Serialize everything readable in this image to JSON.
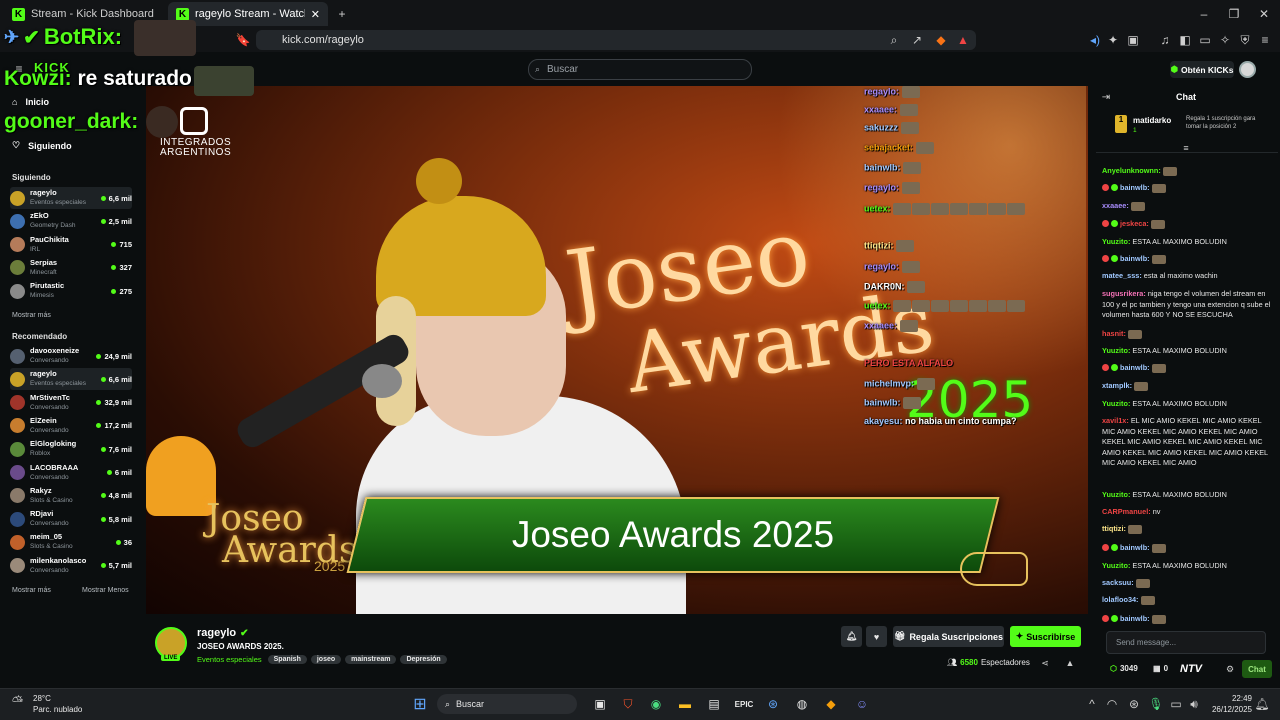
{
  "browser": {
    "tabs": [
      {
        "label": "Stream - Kick Dashboard"
      },
      {
        "label": "rageylo Stream - Watch Live"
      }
    ],
    "url": "kick.com/rageylo"
  },
  "overlay": {
    "botrix": "BotRix:",
    "kick_tag": "KICK",
    "line1_user": "Kowzi:",
    "line1_text": "re saturado",
    "line2_user": "gooner_dark:",
    "sponsor_line1": "INTEGRADOS",
    "sponsor_line2": "ARGENTINOS"
  },
  "header": {
    "search_placeholder": "Buscar",
    "kicks_label": "Obtén KICKs"
  },
  "sidebar": {
    "nav": [
      {
        "label": "Inicio",
        "icon": "home-icon"
      },
      {
        "label": "Siguiendo",
        "icon": "heart-icon"
      }
    ],
    "following_title": "Siguiendo",
    "following": [
      {
        "name": "rageylo",
        "category": "Eventos especiales",
        "viewers": "6,6 mil",
        "color": "#c9a227",
        "selected": true
      },
      {
        "name": "zEkO",
        "category": "Geometry Dash",
        "viewers": "2,5 mil",
        "color": "#3d6fb0"
      },
      {
        "name": "PauChikita",
        "category": "IRL",
        "viewers": "715",
        "color": "#b57b5a"
      },
      {
        "name": "Serpias",
        "category": "Minecraft",
        "viewers": "327",
        "color": "#6b7d3a"
      },
      {
        "name": "Pirutastic",
        "category": "Mimesis",
        "viewers": "275",
        "color": "#8a8a8a"
      }
    ],
    "show_more": "Mostrar más",
    "recommended_title": "Recomendado",
    "recommended": [
      {
        "name": "davooxeneize",
        "category": "Conversando",
        "viewers": "24,9 mil",
        "color": "#556070"
      },
      {
        "name": "rageylo",
        "category": "Eventos especiales",
        "viewers": "6,6 mil",
        "color": "#c9a227",
        "selected": true
      },
      {
        "name": "MrStivenTc",
        "category": "Conversando",
        "viewers": "32,9 mil",
        "color": "#a0342a"
      },
      {
        "name": "ElZeein",
        "category": "Conversando",
        "viewers": "17,2 mil",
        "color": "#c77d2e"
      },
      {
        "name": "ElGlogloking",
        "category": "Roblox",
        "viewers": "7,6 mil",
        "color": "#5a8a3a"
      },
      {
        "name": "LACOBRAAA",
        "category": "Conversando",
        "viewers": "6 mil",
        "color": "#6a4b8a"
      },
      {
        "name": "Rakyz",
        "category": "Slots & Casino",
        "viewers": "4,8 mil",
        "color": "#8a7a6a"
      },
      {
        "name": "RDjavi",
        "category": "Conversando",
        "viewers": "5,8 mil",
        "color": "#2c4a7a"
      },
      {
        "name": "meim_05",
        "category": "Slots & Casino",
        "viewers": "36",
        "color": "#c0602a"
      },
      {
        "name": "milenkanolasco",
        "category": "Conversando",
        "viewers": "5,7 mil",
        "color": "#9a8a7a"
      }
    ],
    "show_more2": "Mostrar más",
    "show_less": "Mostrar Menos"
  },
  "video": {
    "bg_word1": "Joseo",
    "bg_word2": "Awards",
    "bg_year": "2025",
    "lower_logo1": "Joseo",
    "lower_logo2": "Awards",
    "lower_year": "2025",
    "banner_title": "Joseo Awards 2025",
    "onscreen_chat": [
      {
        "user": "regaylo:",
        "text": "",
        "color": "#a78bfa"
      },
      {
        "user": "xxaaee:",
        "text": "",
        "color": "#a78bfa"
      },
      {
        "user": "sakuzzz",
        "text": "",
        "color": "#a0c8ff"
      },
      {
        "user": "sebajacket:",
        "text": "",
        "color": "#f59e0b"
      },
      {
        "user": "bainwlb:",
        "text": "",
        "color": "#a0c8ff"
      },
      {
        "user": "regaylo:",
        "text": "",
        "color": "#a78bfa"
      },
      {
        "user": "uetex:",
        "text": "",
        "color": "#53fc18"
      },
      {
        "user": "ttiqtizi:",
        "text": "",
        "color": "#fde68a"
      },
      {
        "user": "regaylo:",
        "text": "",
        "color": "#a78bfa"
      },
      {
        "user": "DAKR0N:",
        "text": "",
        "color": "#ffffff"
      },
      {
        "user": "uetex:",
        "text": "",
        "color": "#53fc18"
      },
      {
        "user": "xxaaee:",
        "text": "",
        "color": "#a78bfa"
      },
      {
        "user": "",
        "text": "PERO ESTA ALFALO",
        "color": "#ef4444"
      },
      {
        "user": "michelmvp:",
        "text": "",
        "color": "#a0c8ff"
      },
      {
        "user": "bainwlb:",
        "text": "",
        "color": "#a0c8ff"
      },
      {
        "user": "akayesu:",
        "text": "no habia un cinto cumpa?",
        "color": "#a0c8ff"
      }
    ]
  },
  "stream": {
    "channel": "rageylo",
    "title": "JOSEO AWARDS 2025.",
    "category": "Eventos especiales",
    "tags": [
      "Spanish",
      "joseo",
      "mainstream",
      "Depresión"
    ],
    "live_badge": "LIVE",
    "gift_button": "Regala Suscripciones",
    "subscribe_button": "Suscribirse",
    "viewers": "6580",
    "viewers_label": "Espectadores"
  },
  "chat": {
    "title": "Chat",
    "pinned_user": "matidarko",
    "pinned_count": "1",
    "pinned_text": "Regala 1 suscripción gara tomar la posición 2",
    "messages": [
      {
        "user": "Anyelunknownn:",
        "text": "",
        "color": "#53fc18"
      },
      {
        "user": "bainwlb:",
        "text": "",
        "color": "#a0c8ff",
        "badge": true
      },
      {
        "user": "xxaaee:",
        "text": "",
        "color": "#a78bfa"
      },
      {
        "user": "jeskeca:",
        "text": "",
        "color": "#ef4444",
        "badge": true
      },
      {
        "user": "Yuuzito:",
        "text": "ESTA AL MAXIMO BOLUDIN",
        "color": "#53fc18"
      },
      {
        "user": "bainwlb:",
        "text": "",
        "color": "#a0c8ff",
        "badge": true
      },
      {
        "user": "matee_sss:",
        "text": "esta al maximo wachin",
        "color": "#a0c8ff"
      },
      {
        "user": "sugusrikera:",
        "text": "niga tengo el volumen del stream en 100 y el pc tambien y tengo una extencion q sube el volumen hasta 600 Y NO SE ESCUCHA",
        "color": "#f472b6"
      },
      {
        "user": "hasnit:",
        "text": "",
        "color": "#ef4444"
      },
      {
        "user": "Yuuzito:",
        "text": "ESTA AL MAXIMO BOLUDIN",
        "color": "#53fc18"
      },
      {
        "user": "bainwlb:",
        "text": "",
        "color": "#a0c8ff",
        "badge": true
      },
      {
        "user": "xtamplk:",
        "text": "",
        "color": "#a0c8ff"
      },
      {
        "user": "Yuuzito:",
        "text": "ESTA AL MAXIMO BOLUDIN",
        "color": "#53fc18"
      },
      {
        "user": "xavil1x:",
        "text": "EL MIC AMIO KEKEL MIC AMIO KEKEL MIC AMIO KEKEL MIC AMIO KEKEL MIC AMIO KEKEL MIC AMIO KEKEL MIC AMIO KEKEL MIC AMIO KEKEL MIC AMIO KEKEL MIC AMIO KEKEL MIC AMIO KEKEL MIC AMIO",
        "color": "#ef4444"
      },
      {
        "user": "Yuuzito:",
        "text": "ESTA AL MAXIMO BOLUDIN",
        "color": "#53fc18"
      },
      {
        "user": "CARPmanuel:",
        "text": "nv",
        "color": "#ef4444"
      },
      {
        "user": "ttiqtizi:",
        "text": "",
        "color": "#fde68a"
      },
      {
        "user": "bainwlb:",
        "text": "",
        "color": "#a0c8ff",
        "badge": true
      },
      {
        "user": "Yuuzito:",
        "text": "ESTA AL MAXIMO BOLUDIN",
        "color": "#53fc18"
      },
      {
        "user": "sacksuu:",
        "text": "",
        "color": "#a0c8ff"
      },
      {
        "user": "lolafloo34:",
        "text": "",
        "color": "#a0c8ff"
      },
      {
        "user": "bainwlb:",
        "text": "",
        "color": "#a0c8ff",
        "badge": true
      }
    ],
    "input_placeholder": "Send message...",
    "points": "3049",
    "gifts": "0",
    "ntv": "NTV",
    "send_button": "Chat"
  },
  "taskbar": {
    "temp": "28°C",
    "weather": "Parc. nublado",
    "search": "Buscar",
    "time": "22:49",
    "date": "26/12/2025"
  },
  "colors": {
    "accent": "#53fc18",
    "bg": "#0b0e0f"
  }
}
